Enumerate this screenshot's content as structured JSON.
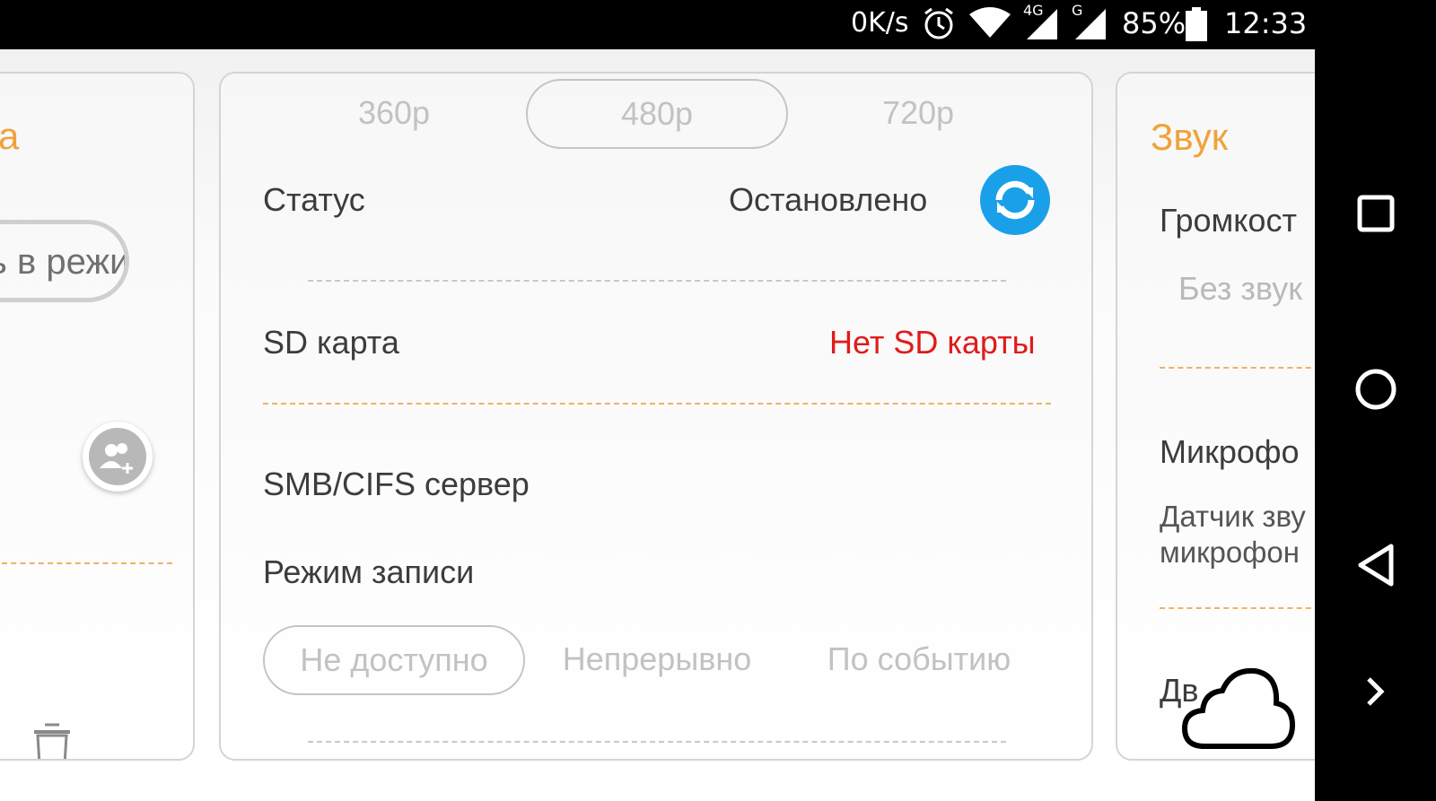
{
  "status_bar": {
    "net_speed": "0K/s",
    "alarm_icon": "alarm-clock-icon",
    "wifi_icon": "wifi-icon",
    "signal1_label": "4G",
    "signal2_label": "G",
    "battery_percent": "85%",
    "time": "12:33"
  },
  "left_card": {
    "title_fragment": "а",
    "button_fragment": "ь в режи",
    "add_user_icon": "add-user-icon",
    "trash_icon": "trash-icon"
  },
  "center_card": {
    "resolutions": [
      "360p",
      "480p",
      "720p"
    ],
    "selected_resolution": "480p",
    "status_label": "Статус",
    "status_value": "Остановлено",
    "refresh_icon": "refresh-icon",
    "sd_label": "SD карта",
    "sd_value": "Нет SD карты",
    "smb_label": "SMB/CIFS сервер",
    "record_mode_label": "Режим записи",
    "record_modes": [
      "Не доступно",
      "Непрерывно",
      "По событию"
    ],
    "selected_record_mode": "Не доступно"
  },
  "right_card": {
    "title": "Звук",
    "volume_label": "Громкост",
    "volume_value": "Без звук",
    "mic_label": "Микрофо",
    "mic_desc_line1": "Датчик зву",
    "mic_desc_line2": "микрофон",
    "motion_fragment": "Дв    ор",
    "cloud_icon": "cloud-icon"
  },
  "nav_bar": {
    "recents_icon": "recents-square-icon",
    "home_icon": "home-circle-icon",
    "back_icon": "back-triangle-icon",
    "more_icon": "chevron-right-icon"
  },
  "colors": {
    "accent": "#f0a23a",
    "error": "#e01b1b",
    "refresh_blue": "#1aa0e8"
  }
}
